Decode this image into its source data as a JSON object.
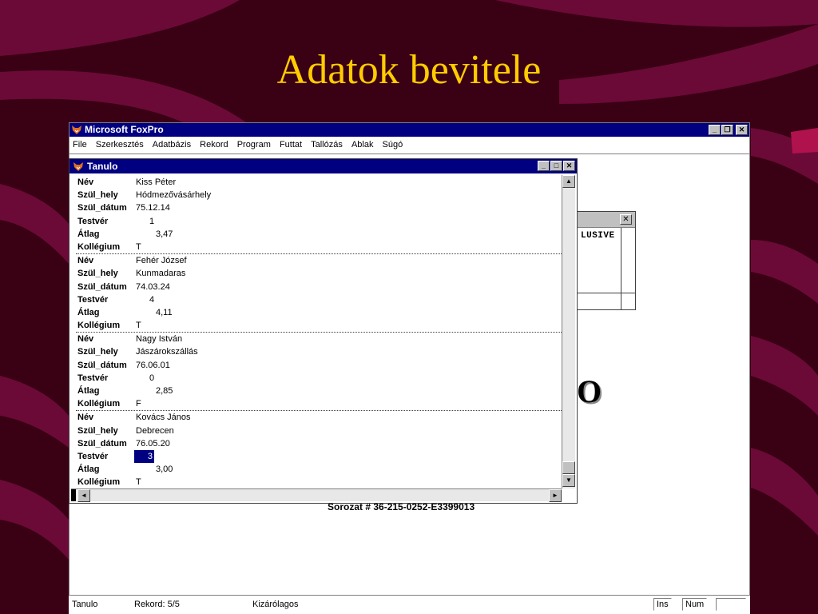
{
  "slide": {
    "title": "Adatok bevitele"
  },
  "app": {
    "title": "Microsoft FoxPro",
    "menu": [
      "File",
      "Szerkesztés",
      "Adatbázis",
      "Rekord",
      "Program",
      "Futtat",
      "Tallózás",
      "Ablak",
      "Súgó"
    ]
  },
  "background_window": {
    "text": "LUSIVE",
    "big_letter": "O",
    "serial": "Sorozat # 36-215-0252-E3399013"
  },
  "browse_window": {
    "title": "Tanulo",
    "labels": [
      "Név",
      "Szül_hely",
      "Szül_dátum",
      "Testvér",
      "Átlag",
      "Kollégium"
    ],
    "records": [
      {
        "nev": "Kiss Péter",
        "szul_hely": "Hódmezővásárhely",
        "szul_datum": "75.12.14",
        "testver": "1",
        "atlag": "3,47",
        "kollegium": "T"
      },
      {
        "nev": "Fehér József",
        "szul_hely": "Kunmadaras",
        "szul_datum": "74.03.24",
        "testver": "4",
        "atlag": "4,11",
        "kollegium": "T"
      },
      {
        "nev": "Nagy István",
        "szul_hely": "Jászárokszállás",
        "szul_datum": "76.06.01",
        "testver": "0",
        "atlag": "2,85",
        "kollegium": "F"
      },
      {
        "nev": "Kovács János",
        "szul_hely": "Debrecen",
        "szul_datum": "76.05.20",
        "testver": "3",
        "atlag": "3,00",
        "kollegium": "T"
      }
    ],
    "selected_record_index": 3,
    "selected_field": "testver"
  },
  "statusbar": {
    "table": "Tanulo",
    "record": "Rekord: 5/5",
    "mode": "Kizárólagos",
    "ins": "Ins",
    "num": "Num"
  },
  "colors": {
    "slide_bg": "#3a0014",
    "stripe": "#6b0a36",
    "title_text": "#ffcc00",
    "titlebar": "#000080",
    "selection": "#000080"
  },
  "icons": {
    "app_icon": "foxpro-fox-icon",
    "minimize": "minimize-icon",
    "maximize": "maximize-icon",
    "restore": "restore-icon",
    "close": "close-icon",
    "scroll_up": "arrow-up-icon",
    "scroll_down": "arrow-down-icon",
    "scroll_left": "arrow-left-icon",
    "scroll_right": "arrow-right-icon"
  }
}
